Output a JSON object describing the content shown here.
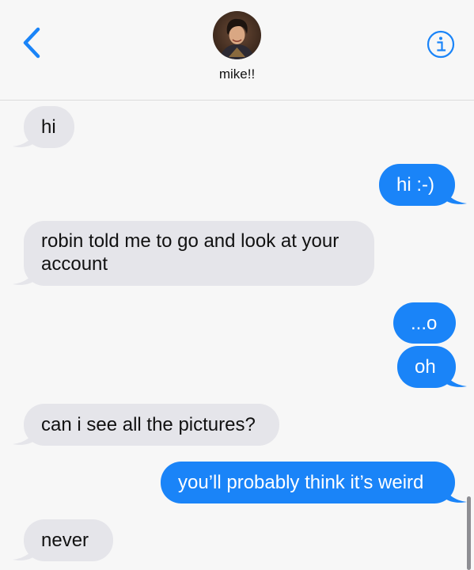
{
  "header": {
    "contact_name": "mike!!",
    "back_icon": "chevron-left-icon",
    "info_icon": "info-circle-icon"
  },
  "colors": {
    "outgoing_bubble": "#1a84f8",
    "incoming_bubble": "#e5e5ea",
    "accent": "#1a84f8"
  },
  "messages": [
    {
      "direction": "incoming",
      "text": "hi"
    },
    {
      "direction": "outgoing",
      "text": "hi :-)"
    },
    {
      "direction": "incoming",
      "line1": "robin told me to go and look at your",
      "line2": "account"
    },
    {
      "direction": "outgoing",
      "text": "...o"
    },
    {
      "direction": "outgoing",
      "text": "oh"
    },
    {
      "direction": "incoming",
      "text": "can i see all the pictures?"
    },
    {
      "direction": "outgoing",
      "text": "you’ll probably think it’s weird"
    },
    {
      "direction": "incoming",
      "text": "never"
    }
  ]
}
